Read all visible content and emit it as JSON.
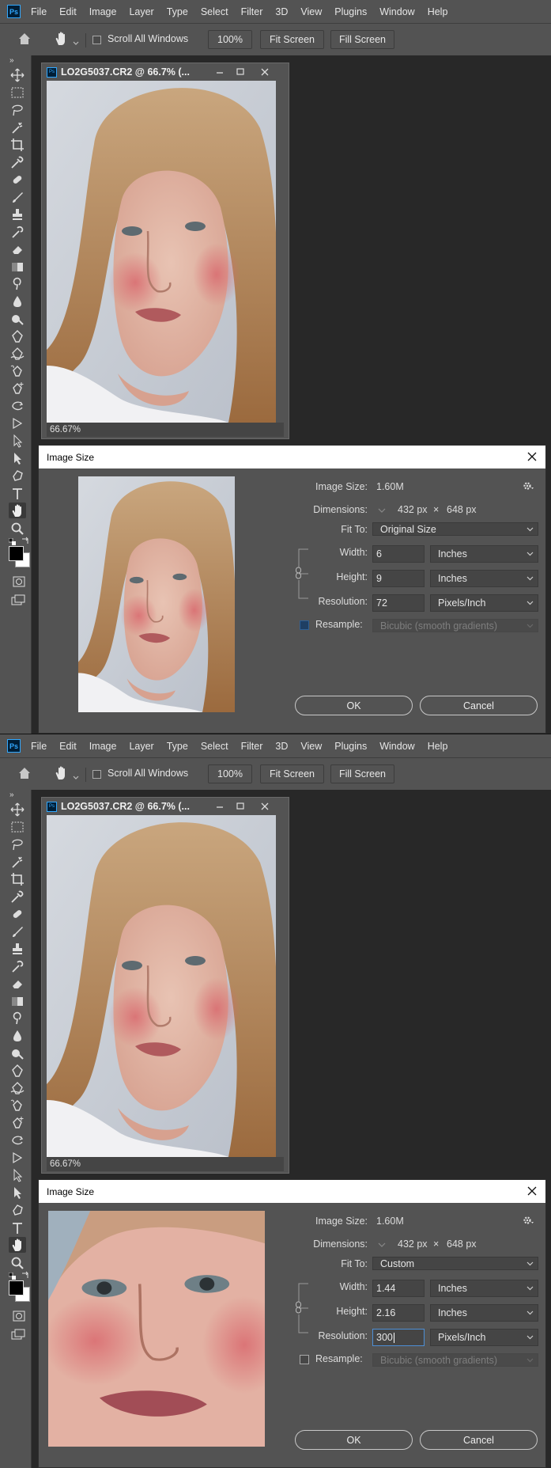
{
  "menu": [
    "File",
    "Edit",
    "Image",
    "Layer",
    "Type",
    "Select",
    "Filter",
    "3D",
    "View",
    "Plugins",
    "Window",
    "Help"
  ],
  "app_logo": "Ps",
  "options": {
    "scroll_all": "Scroll All Windows",
    "zoom": "100%",
    "fit_screen": "Fit Screen",
    "fill_screen": "Fill Screen"
  },
  "document": {
    "title": "LO2G5037.CR2 @ 66.7% (...",
    "zoom_status": "66.67%"
  },
  "dialog_common": {
    "title": "Image Size",
    "image_size_label": "Image Size:",
    "image_size_value": "1.60M",
    "dimensions_label": "Dimensions:",
    "dim_w": "432 px",
    "dim_x": "×",
    "dim_h": "648 px",
    "fit_to_label": "Fit To:",
    "width_label": "Width:",
    "height_label": "Height:",
    "resolution_label": "Resolution:",
    "resample_label": "Resample:",
    "resample_method": "Bicubic (smooth gradients)",
    "ok": "OK",
    "cancel": "Cancel"
  },
  "panels": [
    {
      "fit_to": "Original Size",
      "width": "6",
      "width_unit": "Inches",
      "height": "9",
      "height_unit": "Inches",
      "resolution": "72",
      "resolution_unit": "Pixels/Inch",
      "resample_checked": true
    },
    {
      "fit_to": "Custom",
      "width": "1.44",
      "width_unit": "Inches",
      "height": "2.16",
      "height_unit": "Inches",
      "resolution": "300",
      "resolution_unit": "Pixels/Inch",
      "resample_checked": false
    }
  ]
}
